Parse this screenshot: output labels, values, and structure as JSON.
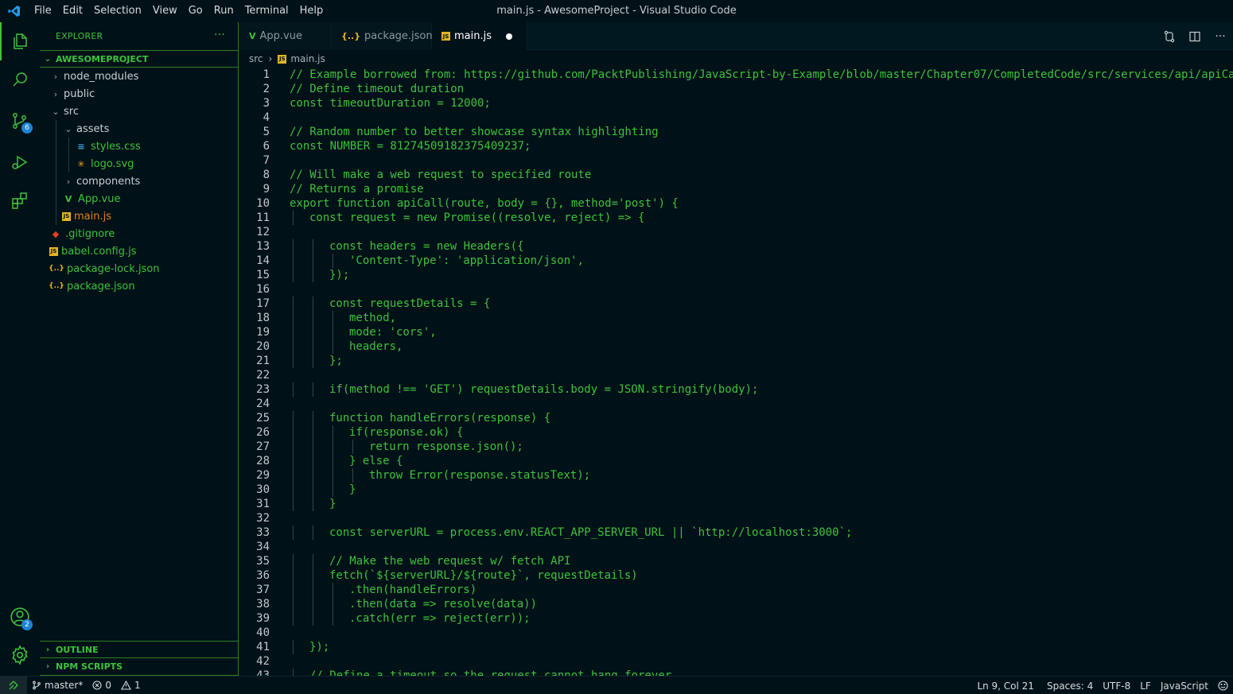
{
  "window": {
    "title": "main.js - AwesomeProject - Visual Studio Code"
  },
  "menu": [
    "File",
    "Edit",
    "Selection",
    "View",
    "Go",
    "Run",
    "Terminal",
    "Help"
  ],
  "activity_bar": {
    "items": [
      {
        "icon": "files-icon",
        "active": true
      },
      {
        "icon": "search-icon"
      },
      {
        "icon": "source-control-icon",
        "badge": "6"
      },
      {
        "icon": "run-debug-icon"
      },
      {
        "icon": "extensions-icon"
      }
    ],
    "bottom": [
      {
        "icon": "accounts-icon",
        "badge": "2"
      },
      {
        "icon": "settings-gear-icon"
      }
    ]
  },
  "sidebar": {
    "title": "EXPLORER",
    "more": "···",
    "project": "AWESOMEPROJECT",
    "tree": [
      {
        "label": "node_modules",
        "type": "folder",
        "open": false,
        "depth": 0
      },
      {
        "label": "public",
        "type": "folder",
        "open": false,
        "depth": 0
      },
      {
        "label": "src",
        "type": "folder",
        "open": true,
        "depth": 0
      },
      {
        "label": "assets",
        "type": "folder",
        "open": true,
        "depth": 1
      },
      {
        "label": "styles.css",
        "type": "css",
        "depth": 2
      },
      {
        "label": "logo.svg",
        "type": "svg",
        "depth": 2
      },
      {
        "label": "components",
        "type": "folder",
        "open": false,
        "depth": 1
      },
      {
        "label": "App.vue",
        "type": "vue",
        "depth": 1
      },
      {
        "label": "main.js",
        "type": "js",
        "depth": 1,
        "modified": true
      },
      {
        "label": ".gitignore",
        "type": "git",
        "depth": 0
      },
      {
        "label": "babel.config.js",
        "type": "js",
        "depth": 0
      },
      {
        "label": "package-lock.json",
        "type": "json",
        "depth": 0
      },
      {
        "label": "package.json",
        "type": "json",
        "depth": 0
      }
    ],
    "outline": "OUTLINE",
    "npm_scripts": "NPM SCRIPTS"
  },
  "tabs": [
    {
      "label": "App.vue",
      "type": "vue",
      "active": false
    },
    {
      "label": "package.json",
      "type": "json",
      "active": false
    },
    {
      "label": "main.js",
      "type": "js",
      "active": true,
      "dirty": true
    }
  ],
  "breadcrumb": {
    "folder": "src",
    "file": "main.js"
  },
  "code": {
    "lines": [
      "// Example borrowed from: https://github.com/PacktPublishing/JavaScript-by-Example/blob/master/Chapter07/CompletedCode/src/services/api/apiCa",
      "// Define timeout duration",
      "const timeoutDuration = 12000;",
      "",
      "// Random number to better showcase syntax highlighting",
      "const NUMBER = 81274509182375409237;",
      "",
      "// Will make a web request to specified route",
      "// Returns a promise",
      "export function apiCall(route, body = {}, method='post') {",
      "  const request = new Promise((resolve, reject) => {",
      "",
      "    const headers = new Headers({",
      "      'Content-Type': 'application/json',",
      "    });",
      "",
      "    const requestDetails = {",
      "      method,",
      "      mode: 'cors',",
      "      headers,",
      "    };",
      "",
      "    if(method !== 'GET') requestDetails.body = JSON.stringify(body);",
      "",
      "    function handleErrors(response) {",
      "      if(response.ok) {",
      "        return response.json();",
      "      } else {",
      "        throw Error(response.statusText);",
      "      }",
      "    }",
      "",
      "    const serverURL = process.env.REACT_APP_SERVER_URL || `http://localhost:3000`;",
      "",
      "    // Make the web request w/ fetch API",
      "    fetch(`${serverURL}/${route}`, requestDetails)",
      "      .then(handleErrors)",
      "      .then(data => resolve(data))",
      "      .catch(err => reject(err));",
      "",
      "  });",
      "",
      "  // Define a timeout so the request cannot hang forever"
    ]
  },
  "status_bar": {
    "branch": "master*",
    "errors": "0",
    "warnings": "1",
    "position": "Ln 9, Col 21",
    "spaces": "Spaces: 4",
    "encoding": "UTF-8",
    "eol": "LF",
    "language": "JavaScript"
  },
  "colors": {
    "accent": "#3ec23c",
    "background": "#011118",
    "badge": "#1b84d4"
  }
}
